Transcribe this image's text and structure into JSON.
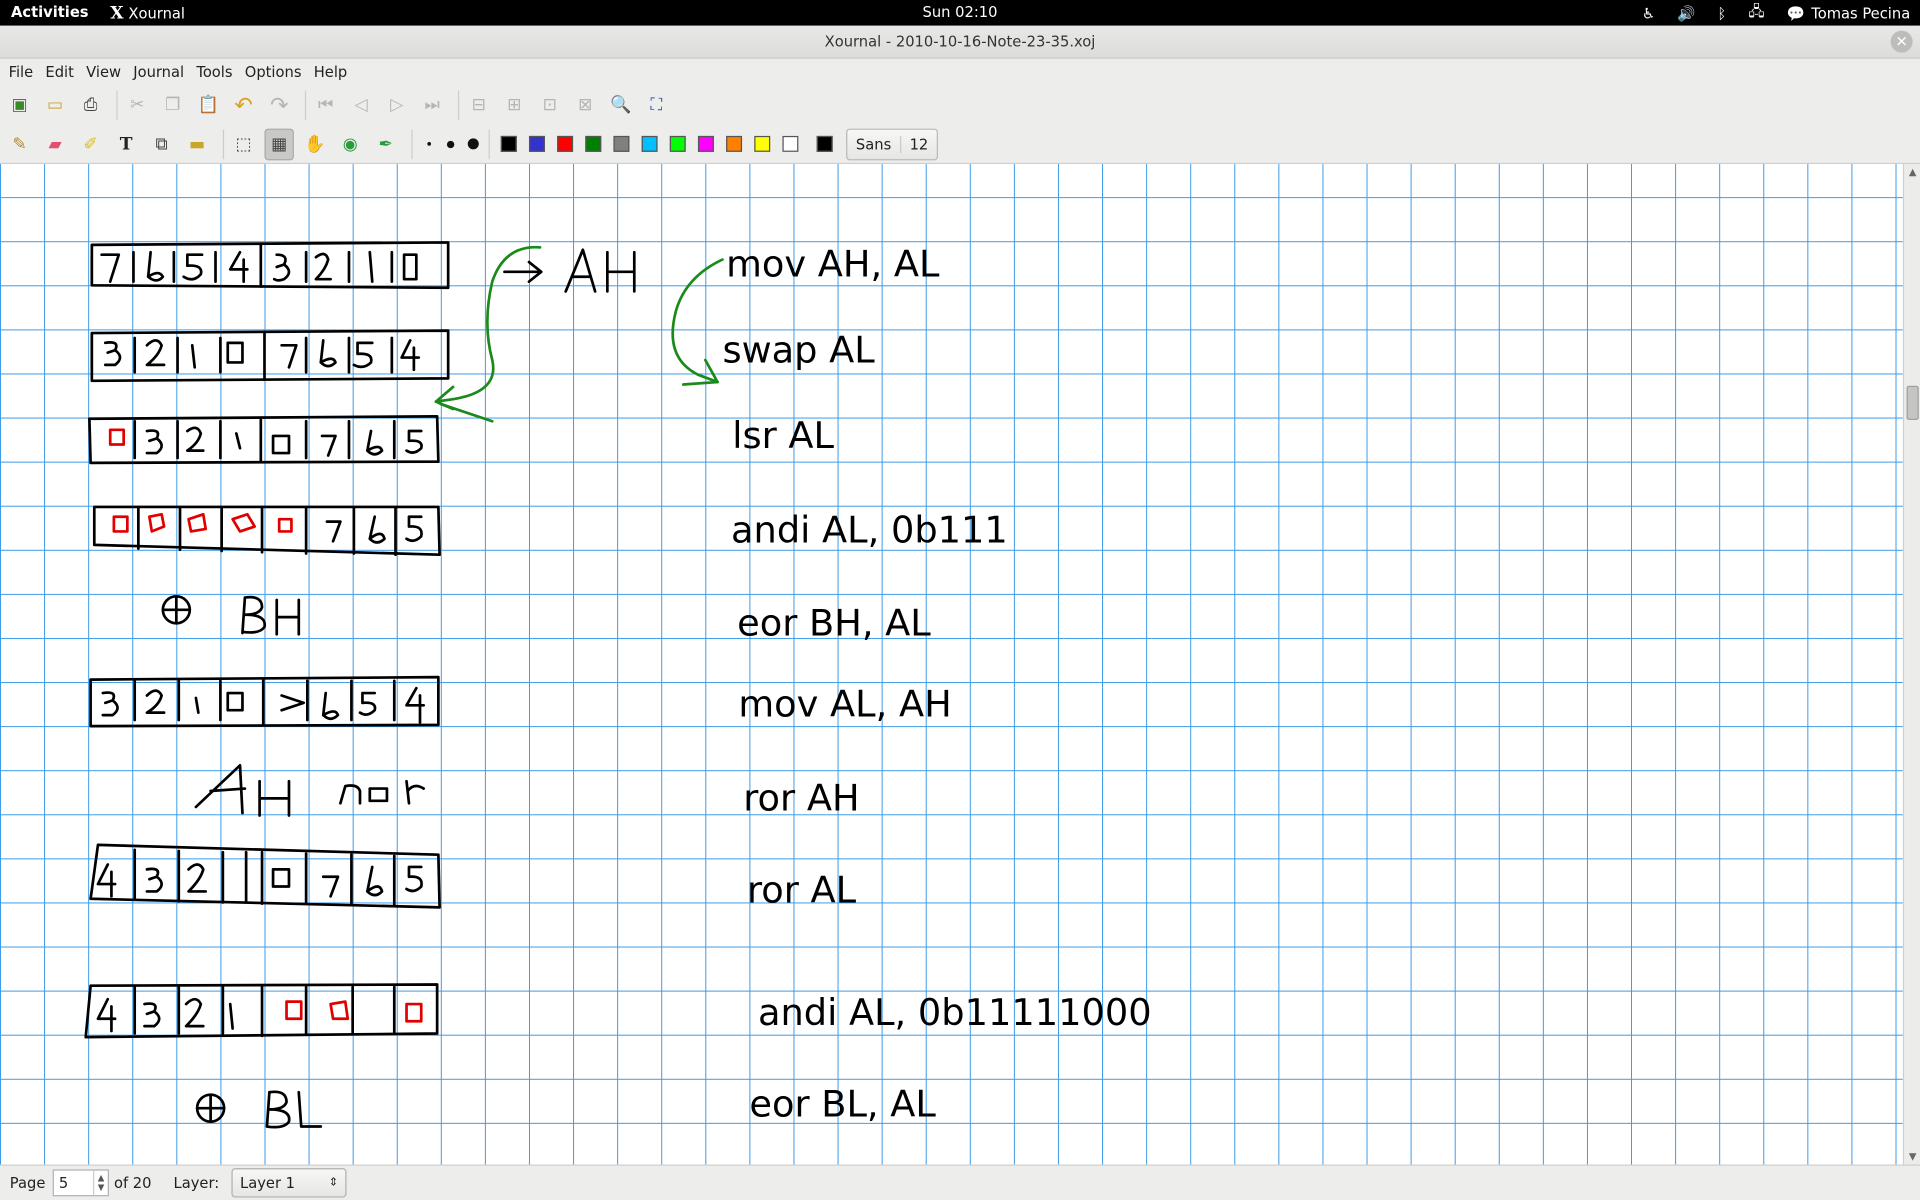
{
  "topbar": {
    "activities": "Activities",
    "app_name": "Xournal",
    "clock": "Sun 02:10",
    "user": "Tomas Pecina"
  },
  "window": {
    "title": "Xournal - 2010-10-16-Note-23-35.xoj"
  },
  "menu": [
    "File",
    "Edit",
    "View",
    "Journal",
    "Tools",
    "Options",
    "Help"
  ],
  "toolbar": {
    "font_name": "Sans",
    "font_size": "12",
    "colors": [
      "#000000",
      "#3333cc",
      "#ff0000",
      "#008000",
      "#808080",
      "#00c0ff",
      "#00ff00",
      "#ff00ff",
      "#ff8000",
      "#ffff00",
      "#ffffff"
    ],
    "current_color": "#000000"
  },
  "notes": [
    "mov AH, AL",
    "swap AL",
    "lsr AL",
    "andi AL, 0b111",
    "eor BH, AL",
    "mov AL, AH",
    "ror AH",
    "ror AL",
    "andi AL, 0b11111000",
    "eor BL, AL"
  ],
  "grid_color": "#3d9be9",
  "status": {
    "page_label": "Page",
    "page_value": "5",
    "page_total": "of 20",
    "layer_label": "Layer:",
    "layer_value": "Layer 1"
  }
}
